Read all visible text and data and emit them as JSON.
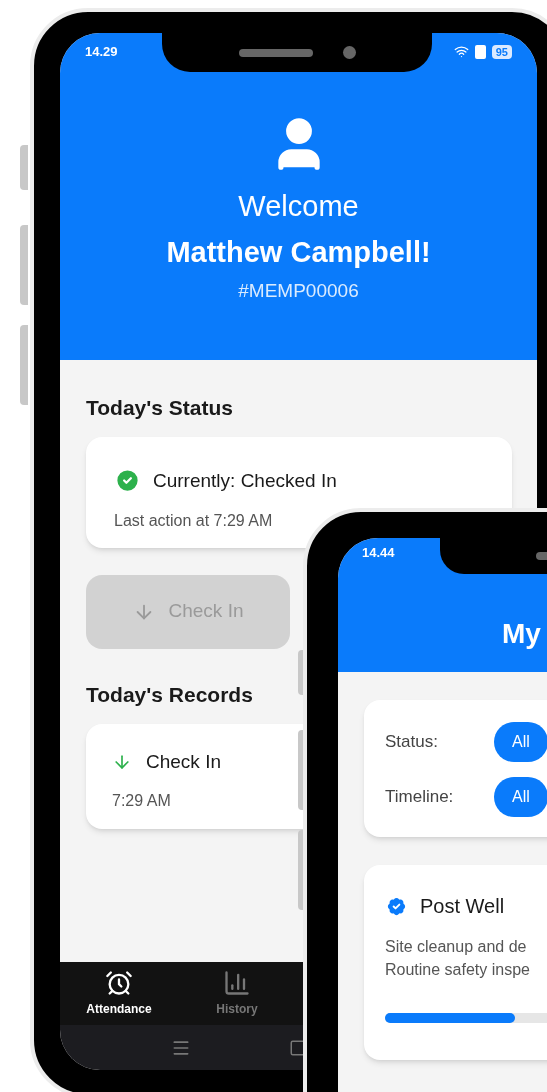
{
  "main_phone": {
    "status_bar": {
      "time": "14.29",
      "battery": "95"
    },
    "header": {
      "greeting": "Welcome",
      "name": "Matthew Campbell!",
      "employee_id": "#MEMP00006"
    },
    "status_section": {
      "title": "Today's Status",
      "state": "Currently: Checked In",
      "checked_in": true,
      "last_action": "Last action at 7:29 AM"
    },
    "check_in_button": {
      "label": "Check In",
      "disabled": true
    },
    "records_section": {
      "title": "Today's Records",
      "records": [
        {
          "label": "Check In",
          "time": "7:29 AM"
        }
      ]
    },
    "bottom_nav": [
      {
        "label": "Attendance",
        "selected": true
      },
      {
        "label": "History",
        "selected": false
      }
    ]
  },
  "second_phone": {
    "status_bar": {
      "time": "14.44"
    },
    "header": {
      "title": "My"
    },
    "filters": [
      {
        "label": "Status:",
        "chip": "All",
        "selected": true
      },
      {
        "label": "Timeline:",
        "chip": "All",
        "selected": true
      }
    ],
    "project": {
      "name": "Post Well",
      "lines": [
        "Site cleanup and de",
        "Routine safety inspe"
      ],
      "level": 0.5
    }
  }
}
